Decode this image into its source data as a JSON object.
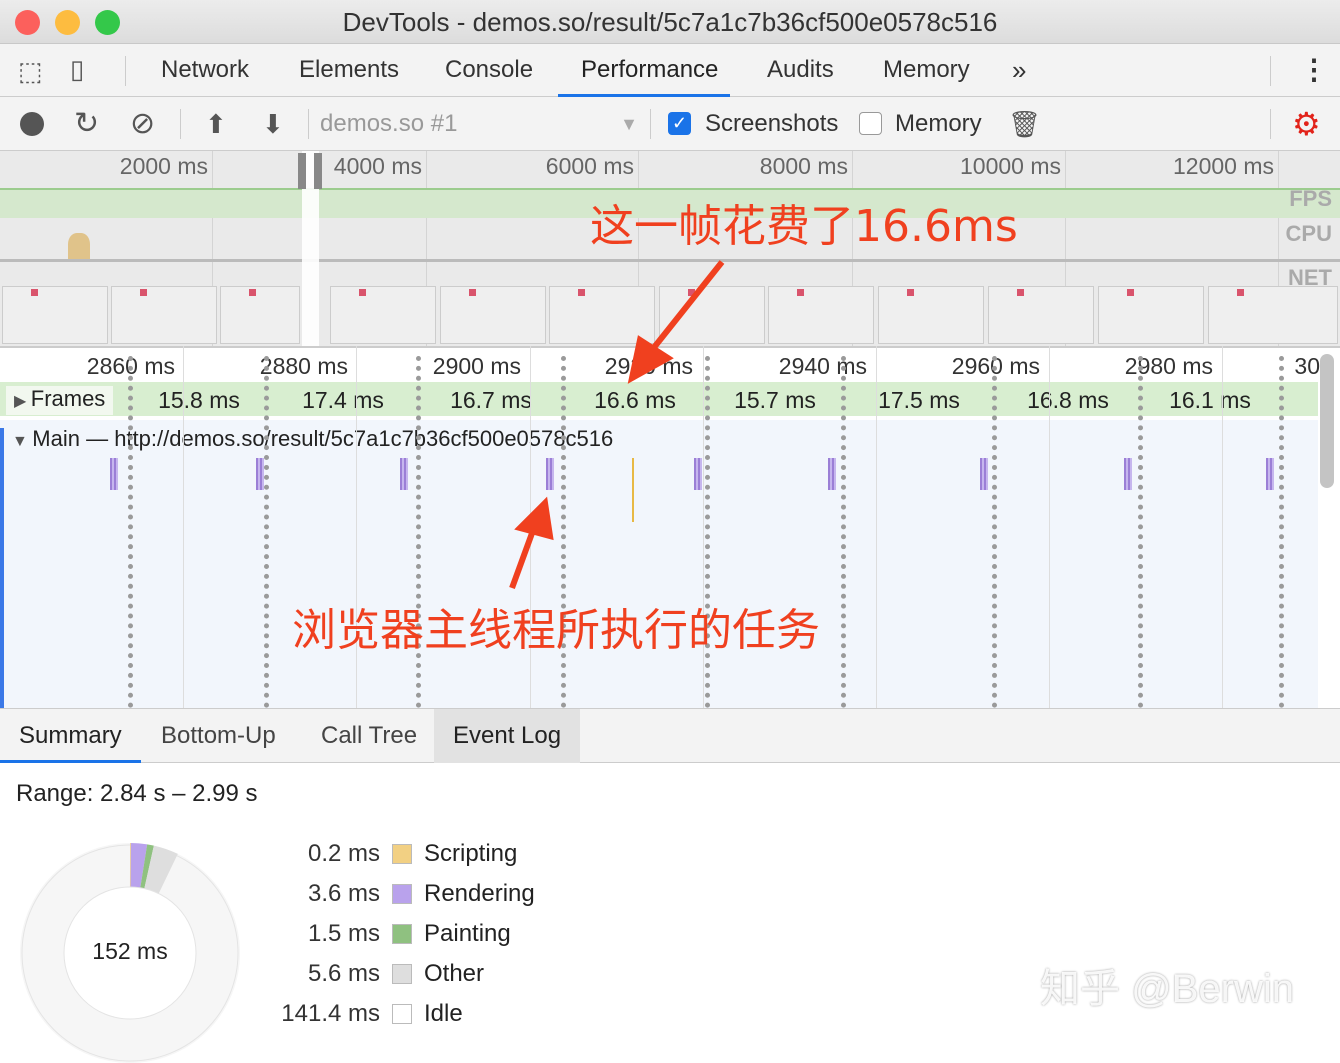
{
  "window": {
    "title": "DevTools - demos.so/result/5c7a1c7b36cf500e0578c516"
  },
  "tabs": [
    {
      "label": "Network"
    },
    {
      "label": "Elements"
    },
    {
      "label": "Console"
    },
    {
      "label": "Performance"
    },
    {
      "label": "Audits"
    },
    {
      "label": "Memory"
    }
  ],
  "toolbar": {
    "target": "demos.so #1",
    "screenshots_label": "Screenshots",
    "screenshots_checked": true,
    "memory_label": "Memory",
    "memory_checked": false
  },
  "overview": {
    "ticks": [
      "2000 ms",
      "4000 ms",
      "6000 ms",
      "8000 ms",
      "10000 ms",
      "12000 ms"
    ],
    "labels": {
      "fps": "FPS",
      "cpu": "CPU",
      "net": "NET"
    }
  },
  "timeline": {
    "ticks": [
      "2860 ms",
      "2880 ms",
      "2900 ms",
      "2920 ms",
      "2940 ms",
      "2960 ms",
      "2980 ms",
      "30"
    ],
    "frames_label": "Frames",
    "frames": [
      "15.8 ms",
      "17.4 ms",
      "16.7 ms",
      "16.6 ms",
      "15.7 ms",
      "17.5 ms",
      "16.8 ms",
      "16.1 ms"
    ],
    "main_label": "Main — http://demos.so/result/5c7a1c7b36cf500e0578c516"
  },
  "bottom_tabs": [
    {
      "label": "Summary"
    },
    {
      "label": "Bottom-Up"
    },
    {
      "label": "Call Tree"
    },
    {
      "label": "Event Log"
    }
  ],
  "summary": {
    "range": "Range: 2.84 s – 2.99 s",
    "total": "152 ms",
    "legend": [
      {
        "value": "0.2 ms",
        "label": "Scripting",
        "color": "#f2d083"
      },
      {
        "value": "3.6 ms",
        "label": "Rendering",
        "color": "#b9a2ec"
      },
      {
        "value": "1.5 ms",
        "label": "Painting",
        "color": "#8fc180"
      },
      {
        "value": "5.6 ms",
        "label": "Other",
        "color": "#dedede"
      },
      {
        "value": "141.4 ms",
        "label": "Idle",
        "color": "#ffffff"
      }
    ]
  },
  "annotations": {
    "frame_note": "这一帧花费了16.6ms",
    "main_note": "浏览器主线程所执行的任务"
  },
  "watermark": "知乎 @Berwin"
}
